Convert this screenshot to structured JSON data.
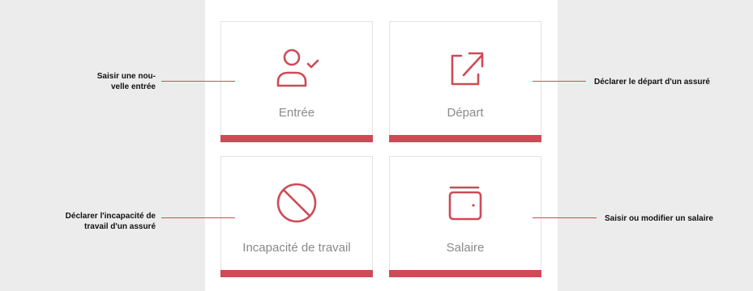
{
  "tiles": {
    "entree": {
      "label": "Entrée",
      "icon": "user-check-icon"
    },
    "depart": {
      "label": "Départ",
      "icon": "external-link-icon"
    },
    "incapacite": {
      "label": "Incapacité de travail",
      "icon": "prohibited-icon"
    },
    "salaire": {
      "label": "Salaire",
      "icon": "wallet-icon"
    }
  },
  "callouts": {
    "entree_line1": "Saisir une nou-",
    "entree_line2": "velle entrée",
    "depart": "Déclarer le départ d'un assuré",
    "incapacite_line1": "Déclarer l'incapacité de",
    "incapacite_line2": "travail d'un assuré",
    "salaire": "Saisir ou modifier un salaire"
  },
  "colors": {
    "accent": "#cd4b56",
    "side_panel": "#ececec",
    "tile_label": "#8a8a8a"
  }
}
